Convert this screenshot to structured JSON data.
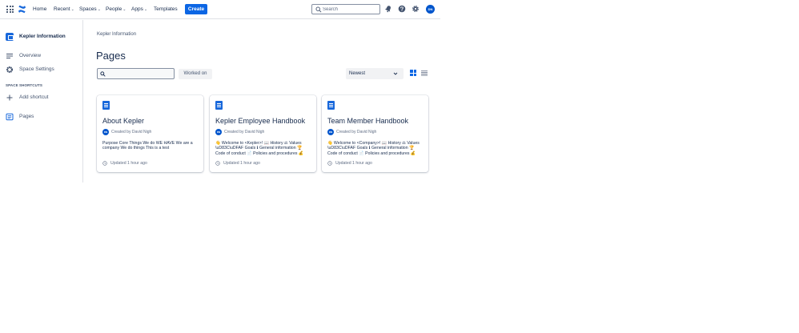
{
  "topnav": {
    "items": [
      {
        "label": "Home",
        "chevron": false
      },
      {
        "label": "Recent",
        "chevron": true
      },
      {
        "label": "Spaces",
        "chevron": true
      },
      {
        "label": "People",
        "chevron": true
      },
      {
        "label": "Apps",
        "chevron": true
      },
      {
        "label": "Templates",
        "chevron": false
      }
    ],
    "create_label": "Create",
    "search_placeholder": "Search",
    "avatar_initials": "DN",
    "icons": [
      "app-switcher-icon",
      "confluence-logo-icon",
      "notifications-icon",
      "help-icon",
      "settings-icon"
    ]
  },
  "sidebar": {
    "space_name": "Kepler Information",
    "items": [
      {
        "label": "Overview",
        "icon": "overview-icon"
      },
      {
        "label": "Space Settings",
        "icon": "gear-icon"
      }
    ],
    "shortcuts_heading": "SPACE SHORTCUTS",
    "add_shortcut_label": "Add shortcut",
    "pages_label": "Pages"
  },
  "main": {
    "breadcrumb": "Kepler Information",
    "title": "Pages",
    "filter_placeholder": "",
    "worked_on_label": "Worked on",
    "sort_value": "Newest"
  },
  "cards": [
    {
      "title": "About Kepler",
      "author_initials": "DN",
      "created_by": "Created by David Nigh",
      "excerpt": "Purpose Core Things We do WE HAVE We are a company We do things This is a test",
      "updated": "Updated 1 hour ago"
    },
    {
      "title": "Kepler Employee Handbook",
      "author_initials": "DN",
      "created_by": "Created by David Nigh",
      "excerpt": "👋 Welcome to <Kepler>! 📖 History ⚖ Values \\uD83C\\uDFAF Goals ℹ General information 🏆 Code of conduct 📄 Policies and procedures 💰",
      "updated": "Updated 1 hour ago"
    },
    {
      "title": "Team Member Handbook",
      "author_initials": "DN",
      "created_by": "Created by David Nigh",
      "excerpt": "👋 Welcome to <Company>! 📖 History ⚖ Values \\uD83C\\uDFAF Goals ℹ General information 🏆 Code of conduct 📄 Policies and procedures 💰",
      "updated": "Updated 1 hour ago"
    }
  ],
  "colors": {
    "brand_blue": "#0c66e4",
    "space_icon": "#1868db",
    "avatar": "#0055cc",
    "text": "#172b4d",
    "subtle_text": "#626f86"
  }
}
